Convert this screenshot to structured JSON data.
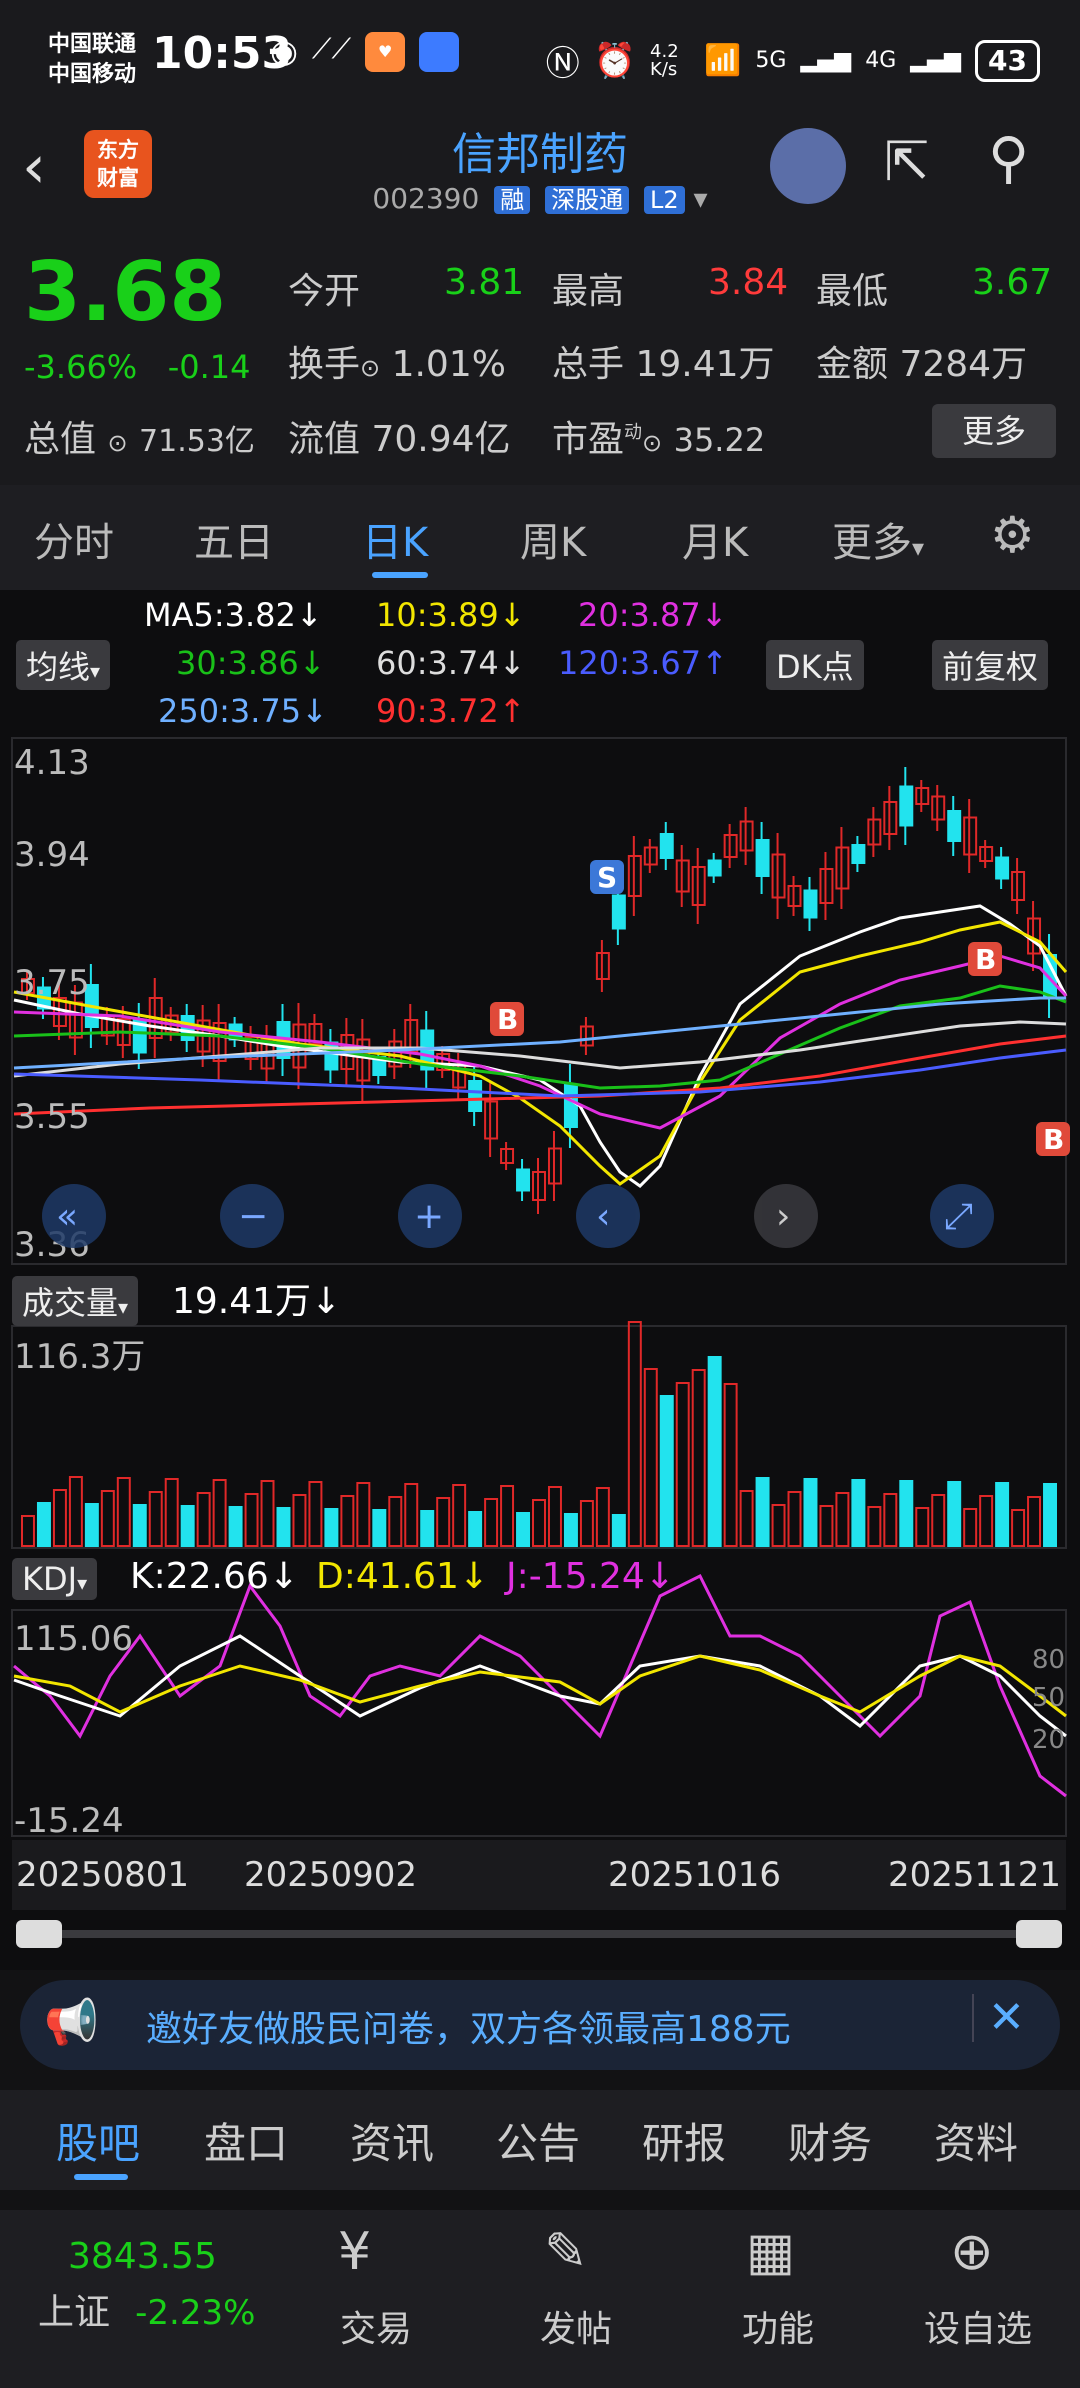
{
  "status": {
    "carrier1": "中国联通",
    "carrier2": "中国移动",
    "time": "10:53",
    "speed": "4.2 K/s",
    "net1": "5G",
    "net2": "4G",
    "battery": "43"
  },
  "header": {
    "logo_line1": "东方",
    "logo_line2": "财富",
    "name": "信邦制药",
    "code": "002390",
    "tag1": "融",
    "tag2": "深股通",
    "tag3": "L2"
  },
  "quote": {
    "price": "3.68",
    "change_pct": "-3.66%",
    "change": "-0.14",
    "open_label": "今开",
    "open": "3.81",
    "high_label": "最高",
    "high": "3.84",
    "low_label": "最低",
    "low": "3.67",
    "turnover_label": "换手",
    "turnover": "1.01%",
    "volume_label": "总手",
    "volume": "19.41万",
    "amount_label": "金额",
    "amount": "7284万",
    "mktcap_label": "总值",
    "mktcap": "71.53亿",
    "float_label": "流值",
    "float": "70.94亿",
    "pe_label": "市盈",
    "pe_sup": "动",
    "pe": "35.22",
    "more": "更多"
  },
  "tabs": [
    "分时",
    "五日",
    "日K",
    "周K",
    "月K",
    "更多"
  ],
  "ma": {
    "selector": "均线",
    "ma5": "MA5:3.82↓",
    "ma10": "10:3.89↓",
    "ma20": "20:3.87↓",
    "ma30": "30:3.86↓",
    "ma60": "60:3.74↓",
    "ma120": "120:3.67↑",
    "ma250": "250:3.75↓",
    "ma90": "90:3.72↑",
    "dk": "DK点",
    "fq": "前复权"
  },
  "price_axis": [
    "4.13",
    "3.94",
    "3.75",
    "3.55",
    "3.36"
  ],
  "volume": {
    "selector": "成交量",
    "value": "19.41万↓",
    "max": "116.3万"
  },
  "kdj": {
    "selector": "KDJ",
    "k": "K:22.66↓",
    "d": "D:41.61↓",
    "j": "J:-15.24↓",
    "max": "115.06",
    "min": "-15.24",
    "r80": "80",
    "r50": "50",
    "r20": "20"
  },
  "dates": [
    "20250801",
    "20250902",
    "20251016",
    "20251121"
  ],
  "banner": {
    "text": "邀好友做股民问卷，双方各领最高188元"
  },
  "bottom_tabs": [
    "股吧",
    "盘口",
    "资讯",
    "公告",
    "研报",
    "财务",
    "资料"
  ],
  "nav": {
    "index_value": "3843.55",
    "index_name": "上证",
    "index_change": "-2.23%",
    "trade": "交易",
    "post": "发帖",
    "func": "功能",
    "watch": "设自选"
  },
  "colors": {
    "up": "#ff3b3b",
    "down": "#19d019",
    "accent": "#4aa3ff",
    "candle_up": "#e02828",
    "candle_down": "#22e3ee"
  }
}
